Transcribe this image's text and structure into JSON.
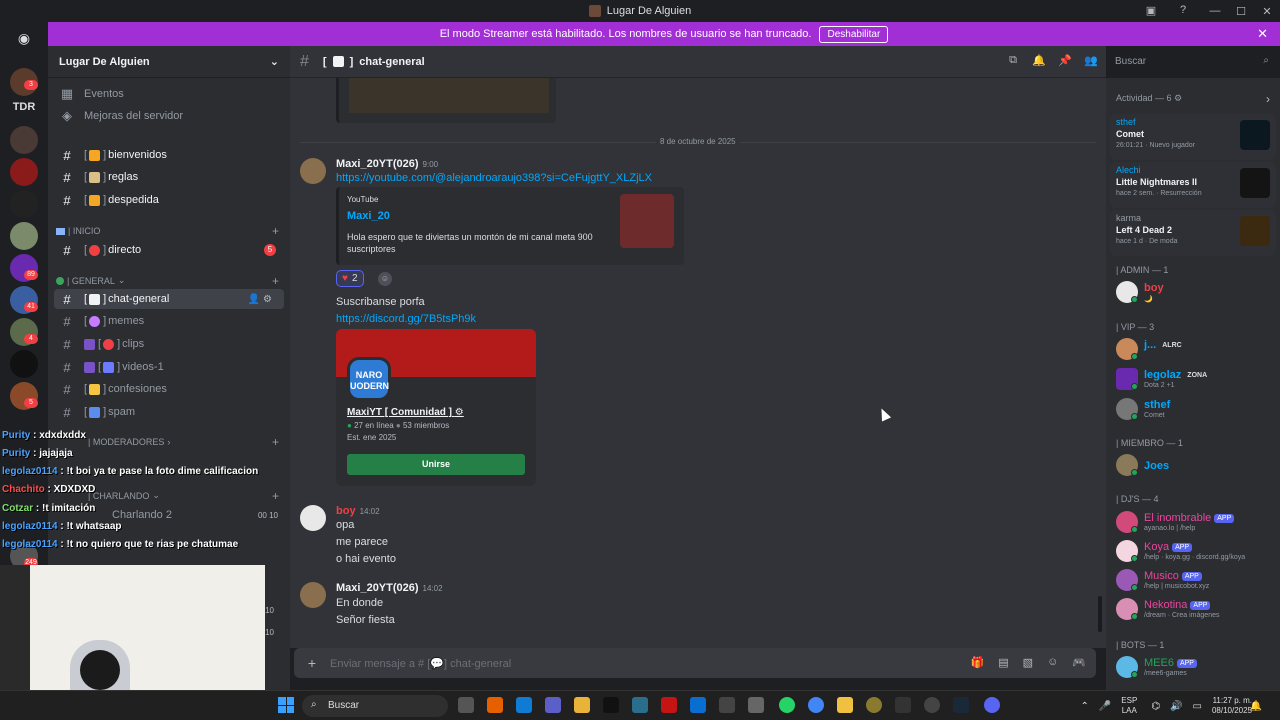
{
  "window": {
    "title": "Lugar De Alguien",
    "controls": [
      "—",
      "☐",
      "✕"
    ]
  },
  "banner": {
    "text": "El modo Streamer está habilitado. Los nombres de usuario se han truncado.",
    "button": "Deshabilitar"
  },
  "rail": {
    "badges": [
      "3",
      "89",
      "41",
      "4",
      "5",
      "249"
    ],
    "tdr_label": "TDR"
  },
  "sidebar": {
    "server_name": "Lugar De Alguien",
    "events": "Eventos",
    "boosts": "Mejoras del servidor",
    "channels_top": [
      {
        "label": "bienvenidos"
      },
      {
        "label": "reglas"
      },
      {
        "label": "despedida"
      }
    ],
    "cat_inicio": "| INICIO",
    "directo": "directo",
    "directo_badge": "5",
    "cat_general": "| GENERAL",
    "channels_general": [
      {
        "label": "chat-general"
      },
      {
        "label": "memes"
      },
      {
        "label": "clips"
      },
      {
        "label": "videos-1"
      },
      {
        "label": "confesiones"
      },
      {
        "label": "spam"
      }
    ],
    "cat_moderadores": "| MODERADORES",
    "cat_charlando": "| CHARLANDO",
    "voice_charlando2": "Charlando 2",
    "voice_counts": [
      "00",
      "10"
    ],
    "side_counts": [
      "10",
      "10"
    ]
  },
  "chat": {
    "channel_name": "chat-general",
    "search_placeholder": "Buscar",
    "date_separator": "8 de octubre de 2025",
    "messages": [
      {
        "author": "Maxi_20YT(026)",
        "time": "9:00",
        "link": "https://youtube.com/@alejandroaraujo398?si=CeFujgttY_XLZjLX",
        "embed_provider": "YouTube",
        "embed_title": "Maxi_20",
        "embed_desc": "Hola espero que te diviertas un montón de mi canal meta 900 suscriptores",
        "reaction_count": "2",
        "text2": "Suscribanse porfa",
        "invite_link": "https://discord.gg/7B5tsPh9k",
        "invite_logo": "NARO UODERN",
        "invite_name": "MaxiYT [ Comunidad ]",
        "invite_online": "27 en línea",
        "invite_members": "53 miembros",
        "invite_est": "Est. ene 2025",
        "invite_join": "Unirse"
      },
      {
        "author": "boy",
        "time": "14:02",
        "lines": [
          "opa",
          "me parece",
          "o hai evento"
        ]
      },
      {
        "author": "Maxi_20YT(026)",
        "time": "14:02",
        "lines": [
          "En donde",
          "Señor fiesta"
        ]
      }
    ],
    "input_placeholder": "Enviar mensaje a # [💬] chat-general"
  },
  "members": {
    "activity_title": "Actividad — 6",
    "activities": [
      {
        "user": "sthef",
        "game": "Comet",
        "meta": "26:01:21 · Nuevo jugador"
      },
      {
        "user": "Alechi",
        "game": "Little Nightmares II",
        "meta": "hace 2 sem. · Resurrección"
      },
      {
        "user": "karma",
        "game": "Left 4 Dead 2",
        "meta": "hace 1 d · De moda"
      }
    ],
    "cat_admin": "| ADMIN — 1",
    "admin": [
      {
        "name": "boy",
        "sub": "🌙",
        "color": "#f23f43"
      }
    ],
    "cat_vip": "| VIP — 3",
    "vip": [
      {
        "name": "j...",
        "sub": "",
        "tag": "ALRC",
        "color": "#00a8fc"
      },
      {
        "name": "legolaz",
        "sub": "Dota 2 +1",
        "tag": "ZONA",
        "color": "#00a8fc"
      },
      {
        "name": "sthef",
        "sub": "Comet",
        "color": "#00a8fc"
      }
    ],
    "cat_miembro": "| MIEMBRO — 1",
    "miembro": [
      {
        "name": "Joes",
        "sub": "",
        "color": "#00a8fc"
      }
    ],
    "cat_djs": "| DJ'S — 4",
    "djs": [
      {
        "name": "El inombrable",
        "sub": "ayanao.lo | /help",
        "app": "APP",
        "color": "#eb459e"
      },
      {
        "name": "Koya",
        "sub": "/help · koya.gg · discord.gg/koya",
        "app": "APP",
        "color": "#eb459e"
      },
      {
        "name": "Musico",
        "sub": "/help | musicobot.xyz",
        "app": "APP",
        "color": "#eb459e"
      },
      {
        "name": "Nekotina",
        "sub": "/dream · Crea imágenes",
        "app": "APP",
        "color": "#eb459e"
      }
    ],
    "cat_bots": "| BOTS — 1",
    "bots": [
      {
        "name": "MEE6",
        "sub": "/mee6-games",
        "app": "APP",
        "color": "#23a55a"
      }
    ]
  },
  "overlay": {
    "lines": [
      {
        "user": "Purity",
        "text": " : xdxdxddx"
      },
      {
        "user": "Purity",
        "text": " : jajajaja"
      },
      {
        "user": "legolaz0114",
        "text": " : !t boi ya te pase la foto dime calificacion"
      },
      {
        "user": "Chachito",
        "text": " : XDXDXD"
      },
      {
        "user": "Cotzar",
        "text": " : !t imitación"
      },
      {
        "user": "legolaz0114",
        "text": " : !t whatsaap"
      },
      {
        "user": "legolaz0114",
        "text": " : !t no quiero que te rias pe chatumae"
      }
    ]
  },
  "taskbar": {
    "search": "Buscar",
    "lang": [
      "ESP",
      "LAA"
    ],
    "time": "11:27 p. m.",
    "date": "08/10/2025"
  }
}
